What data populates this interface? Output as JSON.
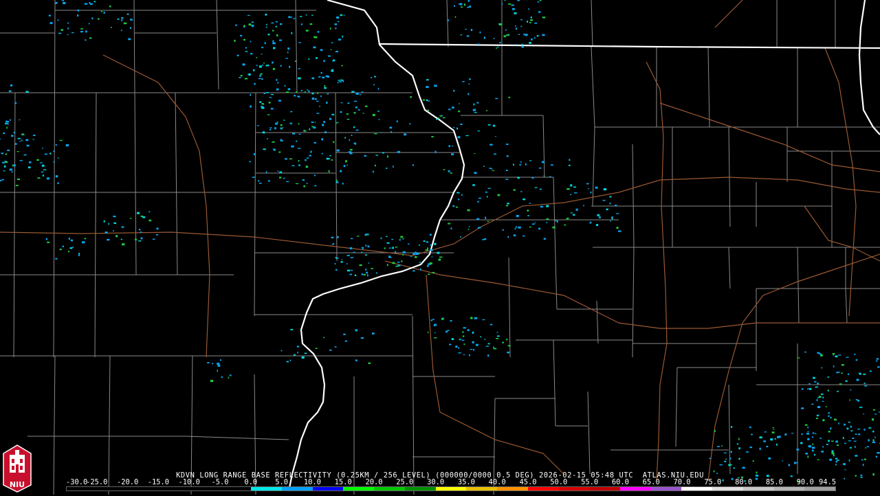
{
  "caption": {
    "radar": "KDVN LONG RANGE BASE REFLECTIVITY (0.25KM / 256 LEVEL) (000000/0000 0.5 DEG) 2026-02-15 05:48 UTC",
    "site": "ATLAS.NIU.EDU"
  },
  "logo_text": "NIU",
  "colorbar": {
    "labels": [
      "-30.0",
      "-25.0",
      "-20.0",
      "-15.0",
      "-10.0",
      "-5.0",
      "0.0",
      "5.0",
      "10.0",
      "15.0",
      "20.0",
      "25.0",
      "30.0",
      "35.0",
      "40.0",
      "45.0",
      "50.0",
      "55.0",
      "60.0",
      "65.0",
      "70.0",
      "75.0",
      "80.0",
      "85.0",
      "90.0",
      "94.5"
    ],
    "colors": [
      "#000000",
      "#000000",
      "#000000",
      "#000000",
      "#000000",
      "#000000",
      "#00e8e8",
      "#03a1f6",
      "#0000f6",
      "#00ff00",
      "#00c800",
      "#009000",
      "#ffff00",
      "#e7c000",
      "#ff9000",
      "#ff0000",
      "#d60000",
      "#c00000",
      "#ff00ff",
      "#9955c9",
      "#ffffff",
      "#e0e0e0",
      "#c8c8c8",
      "#b4b4b4",
      "#a0a0a0"
    ]
  },
  "colors": {
    "state_border": "#ffffff",
    "county_line": "#8a8a8a",
    "highway": "#9a5a33",
    "echo_light": "#0aa6f0",
    "echo_cyan": "#00d8e0",
    "echo_green": "#20c840"
  }
}
